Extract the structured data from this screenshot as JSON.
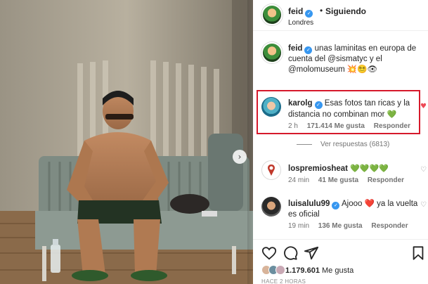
{
  "post": {
    "author": "feid",
    "follow_status": "Siguiendo",
    "location": "Londres",
    "separator": "•",
    "caption": {
      "username": "feid",
      "text": "unas laminitas en europa de cuenta del @sismatyc y el @molomuseum",
      "emojis": "💥😵‍💫👁"
    }
  },
  "comments": [
    {
      "username": "karolg",
      "verified": true,
      "text": "Esas fotos tan ricas y la distancia no combinan mor",
      "emoji": "💚",
      "time": "2 h",
      "likes": "171.414 Me gusta",
      "reply": "Responder",
      "liked": true,
      "view_replies": "Ver respuestas (6813)"
    },
    {
      "username": "lospremiosheat",
      "verified": false,
      "text": "",
      "emoji": "💚💚💚💚",
      "time": "24 min",
      "likes": "41 Me gusta",
      "reply": "Responder",
      "liked": false
    },
    {
      "username": "luisalulu99",
      "verified": true,
      "text": "Ajooo",
      "emoji": "❤️",
      "text_after": "ya la vuelta es oficial",
      "time": "19 min",
      "likes": "136 Me gusta",
      "reply": "Responder",
      "liked": false
    }
  ],
  "actions": {
    "likes_count": "1.179.601",
    "likes_label": "Me gusta",
    "posted_ago": "HACE 2 HORAS"
  },
  "icons": {
    "verified": "check",
    "heart": "♡",
    "heart_filled": "♥",
    "next": "›"
  },
  "colors": {
    "accent_blue": "#3797f0",
    "highlight_red": "#d6192b",
    "like_red": "#ed4956",
    "meta_gray": "#737373"
  }
}
